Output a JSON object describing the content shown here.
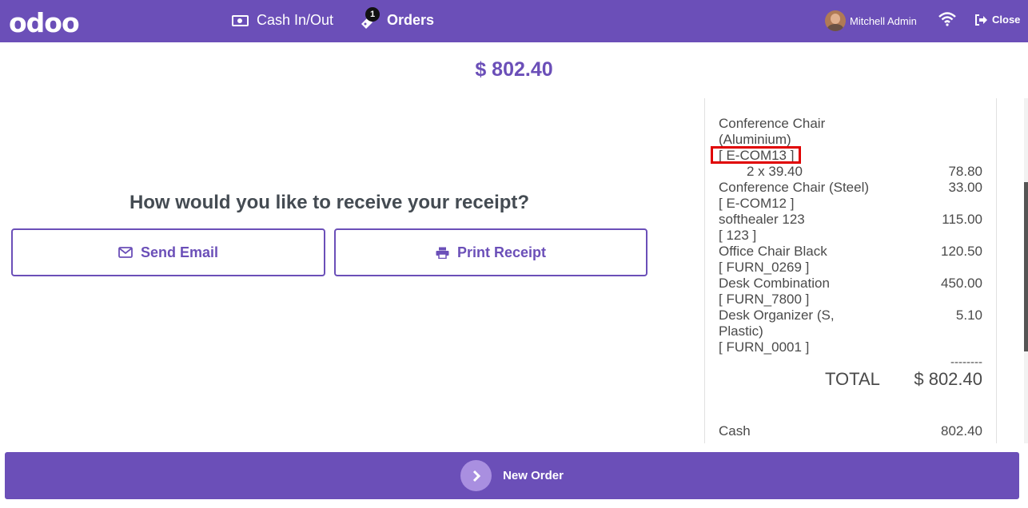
{
  "header": {
    "logo": "odoo",
    "nav": [
      {
        "label": "Cash In/Out",
        "icon": "cash-icon"
      },
      {
        "label": "Orders",
        "icon": "ticket-icon",
        "badge": "1"
      }
    ],
    "user": "Mitchell Admin",
    "close_label": "Close"
  },
  "payment": {
    "amount": "$ 802.40",
    "question": "How would you like to receive your receipt?",
    "send_email": "Send Email",
    "print_receipt": "Print Receipt"
  },
  "receipt": {
    "lines": [
      {
        "name": "Conference Chair",
        "name2": "(Aluminium)",
        "code": "[ E-COM13 ]",
        "qty": "2 x 39.40",
        "price": "78.80"
      },
      {
        "name": "Conference Chair (Steel)",
        "code": "[ E-COM12 ]",
        "price": "33.00"
      },
      {
        "name": "softhealer 123",
        "code": "[ 123 ]",
        "price": "115.00"
      },
      {
        "name": "Office Chair Black",
        "code": "[ FURN_0269 ]",
        "price": "120.50"
      },
      {
        "name": "Desk Combination",
        "code": "[ FURN_7800 ]",
        "price": "450.00"
      },
      {
        "name": "Desk Organizer (S,",
        "name2": "Plastic)",
        "code": "[ FURN_0001 ]",
        "price": "5.10"
      }
    ],
    "separator": "--------",
    "total_label": "TOTAL",
    "total_value": "$ 802.40",
    "payment_method": "Cash",
    "payment_amount": "802.40"
  },
  "footer": {
    "new_order": "New Order"
  },
  "colors": {
    "brand": "#6b4fb8",
    "highlight": "#e00000"
  }
}
